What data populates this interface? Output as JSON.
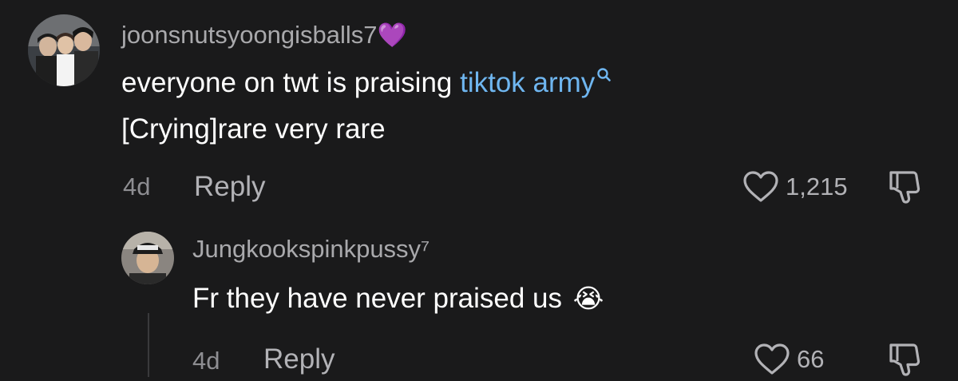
{
  "comments": [
    {
      "username": "joonsnutsyoongisballs7",
      "badge": "💜",
      "text_plain": "everyone on twt is praising ",
      "text_link": "tiktok army",
      "text_line2": "[Crying]rare very rare",
      "age": "4d",
      "reply_label": "Reply",
      "likes": "1,215"
    },
    {
      "username": "Jungkookspinkpussy⁷",
      "text": "Fr they have never praised us",
      "emoji": "😭",
      "age": "4d",
      "reply_label": "Reply",
      "likes": "66"
    }
  ],
  "icons": {
    "search": "search-icon",
    "like": "heart-outline-icon",
    "dislike": "thumbs-down-icon"
  },
  "colors": {
    "background": "#1a1a1b",
    "link": "#6fb6f0",
    "username": "#a9a9ac",
    "meta": "#8e8e92"
  }
}
